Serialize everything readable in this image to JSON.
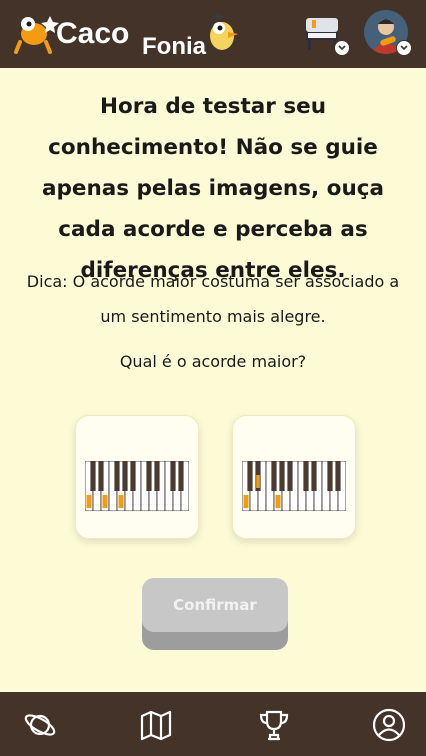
{
  "header": {
    "logo_text": "CacoFonia",
    "instrument_button": "piano-icon",
    "profile_button": "avatar"
  },
  "main": {
    "heading": "Hora de testar seu conhecimento! Não se guie apenas pelas imagens, ouça cada acorde e perceba as diferenças entre eles.",
    "tip": "Dica: O acorde maior costuma ser associado a um sentimento mais alegre.",
    "question": "Qual é o acorde maior?",
    "options": [
      {
        "id": "chord-a",
        "highlighted_white_keys": [
          0,
          2,
          4
        ],
        "highlighted_black_keys": []
      },
      {
        "id": "chord-b",
        "highlighted_white_keys": [
          0,
          4
        ],
        "highlighted_black_keys": [
          1
        ]
      }
    ],
    "confirm_label": "Confirmar",
    "confirm_enabled": false
  },
  "nav": {
    "items": [
      "planet-icon",
      "map-icon",
      "trophy-icon",
      "user-icon"
    ]
  },
  "colors": {
    "header_bg": "#433328",
    "page_bg": "#fdfbd6",
    "highlight": "#f39c12",
    "button_disabled": "#c7c7c7"
  }
}
